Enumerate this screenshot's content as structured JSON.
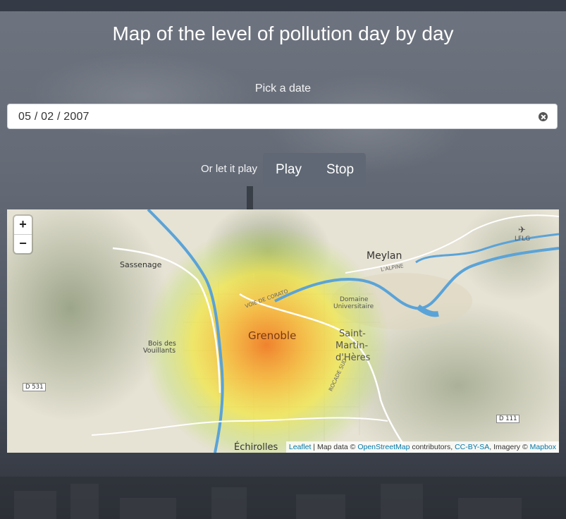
{
  "page": {
    "title": "Map of the level of pollution day by day"
  },
  "date_picker": {
    "label": "Pick a date",
    "value": "05 / 02 / 2007"
  },
  "playback": {
    "prompt": "Or let it play",
    "play_label": "Play",
    "stop_label": "Stop"
  },
  "map": {
    "zoom_in": "+",
    "zoom_out": "−",
    "labels": {
      "grenoble": "Grenoble",
      "saint_martin_1": "Saint-",
      "saint_martin_2": "Martin-",
      "saint_martin_3": "d'Hères",
      "meylan": "Meylan",
      "sassenage": "Sassenage",
      "echirolles": "Échirolles",
      "bois_1": "Bois des",
      "bois_2": "Vouillants",
      "domaine_1": "Domaine",
      "domaine_2": "Universitaire",
      "lflg": "LFLG",
      "d531": "D 531",
      "d111": "D 111",
      "voie_corato": "VOIE DE CORATO",
      "alpine": "L'ALPINE",
      "rocade": "ROCADE SUD"
    },
    "attribution": {
      "leaflet": "Leaflet",
      "sep": " | Map data © ",
      "osm": "OpenStreetMap",
      "contributors": " contributors, ",
      "license": "CC-BY-SA",
      "imagery": ", Imagery © ",
      "mapbox": "Mapbox"
    },
    "heat_colors": {
      "core": "#f07a20",
      "mid": "#f7b531",
      "outer": "#f2e83c",
      "edge": "#bfe05a"
    }
  }
}
